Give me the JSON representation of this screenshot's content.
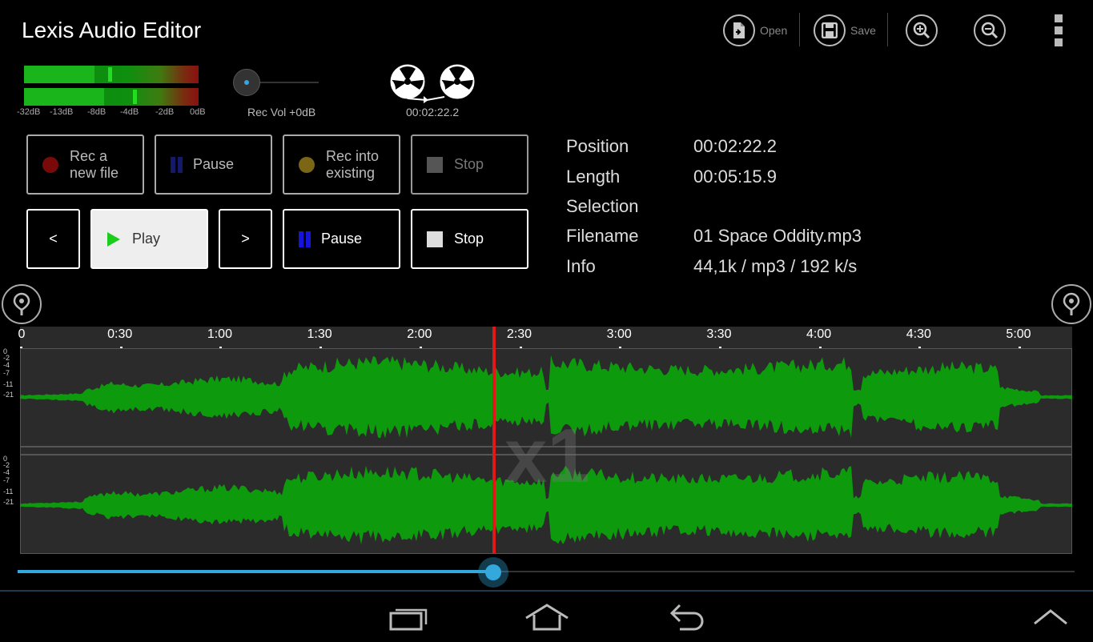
{
  "app": {
    "title": "Lexis Audio Editor"
  },
  "toolbar": {
    "open_label": "Open",
    "save_label": "Save"
  },
  "meters": {
    "db_labels": [
      "-32dB",
      "-13dB",
      "-8dB",
      "-4dB",
      "-2dB",
      "0dB"
    ],
    "left_level": 0.46,
    "right_level": 0.52
  },
  "rec_volume": {
    "label": "Rec Vol +0dB",
    "level": 0.0
  },
  "reel": {
    "time": "00:02:22.2"
  },
  "record_buttons": {
    "rec_new_line1": "Rec a",
    "rec_new_line2": "new file",
    "pause": "Pause",
    "rec_into_line1": "Rec into",
    "rec_into_line2": "existing",
    "stop": "Stop"
  },
  "playback_buttons": {
    "prev": "<",
    "play": "Play",
    "next": ">",
    "pause": "Pause",
    "stop": "Stop"
  },
  "info": {
    "position_label": "Position",
    "position_value": "00:02:22.2",
    "length_label": "Length",
    "length_value": "00:05:15.9",
    "selection_label": "Selection",
    "selection_value": "",
    "filename_label": "Filename",
    "filename_value": "01 Space Oddity.mp3",
    "info_label": "Info",
    "info_value": "44,1k / mp3 / 192 k/s"
  },
  "timeline": {
    "tick_labels": [
      "0",
      "0:30",
      "1:00",
      "1:30",
      "2:00",
      "2:30",
      "3:00",
      "3:30",
      "4:00",
      "4:30",
      "5:00"
    ],
    "db_scale": [
      "0",
      "-2",
      "-4",
      "-7",
      "-11",
      "-21"
    ],
    "zoom": "x1",
    "playhead_fraction": 0.45
  },
  "colors": {
    "waveform": "#0d9a0d",
    "playhead": "#e01818",
    "accent": "#33a8dd"
  },
  "icons": {
    "open": "file-open-icon",
    "save": "floppy-disk-icon",
    "zoom_in": "zoom-in-icon",
    "zoom_out": "zoom-out-icon",
    "overflow": "overflow-menu-icon",
    "marker": "location-pin-icon",
    "recent": "recent-apps-icon",
    "home": "home-icon",
    "back": "back-icon",
    "up": "chevron-up-icon"
  }
}
